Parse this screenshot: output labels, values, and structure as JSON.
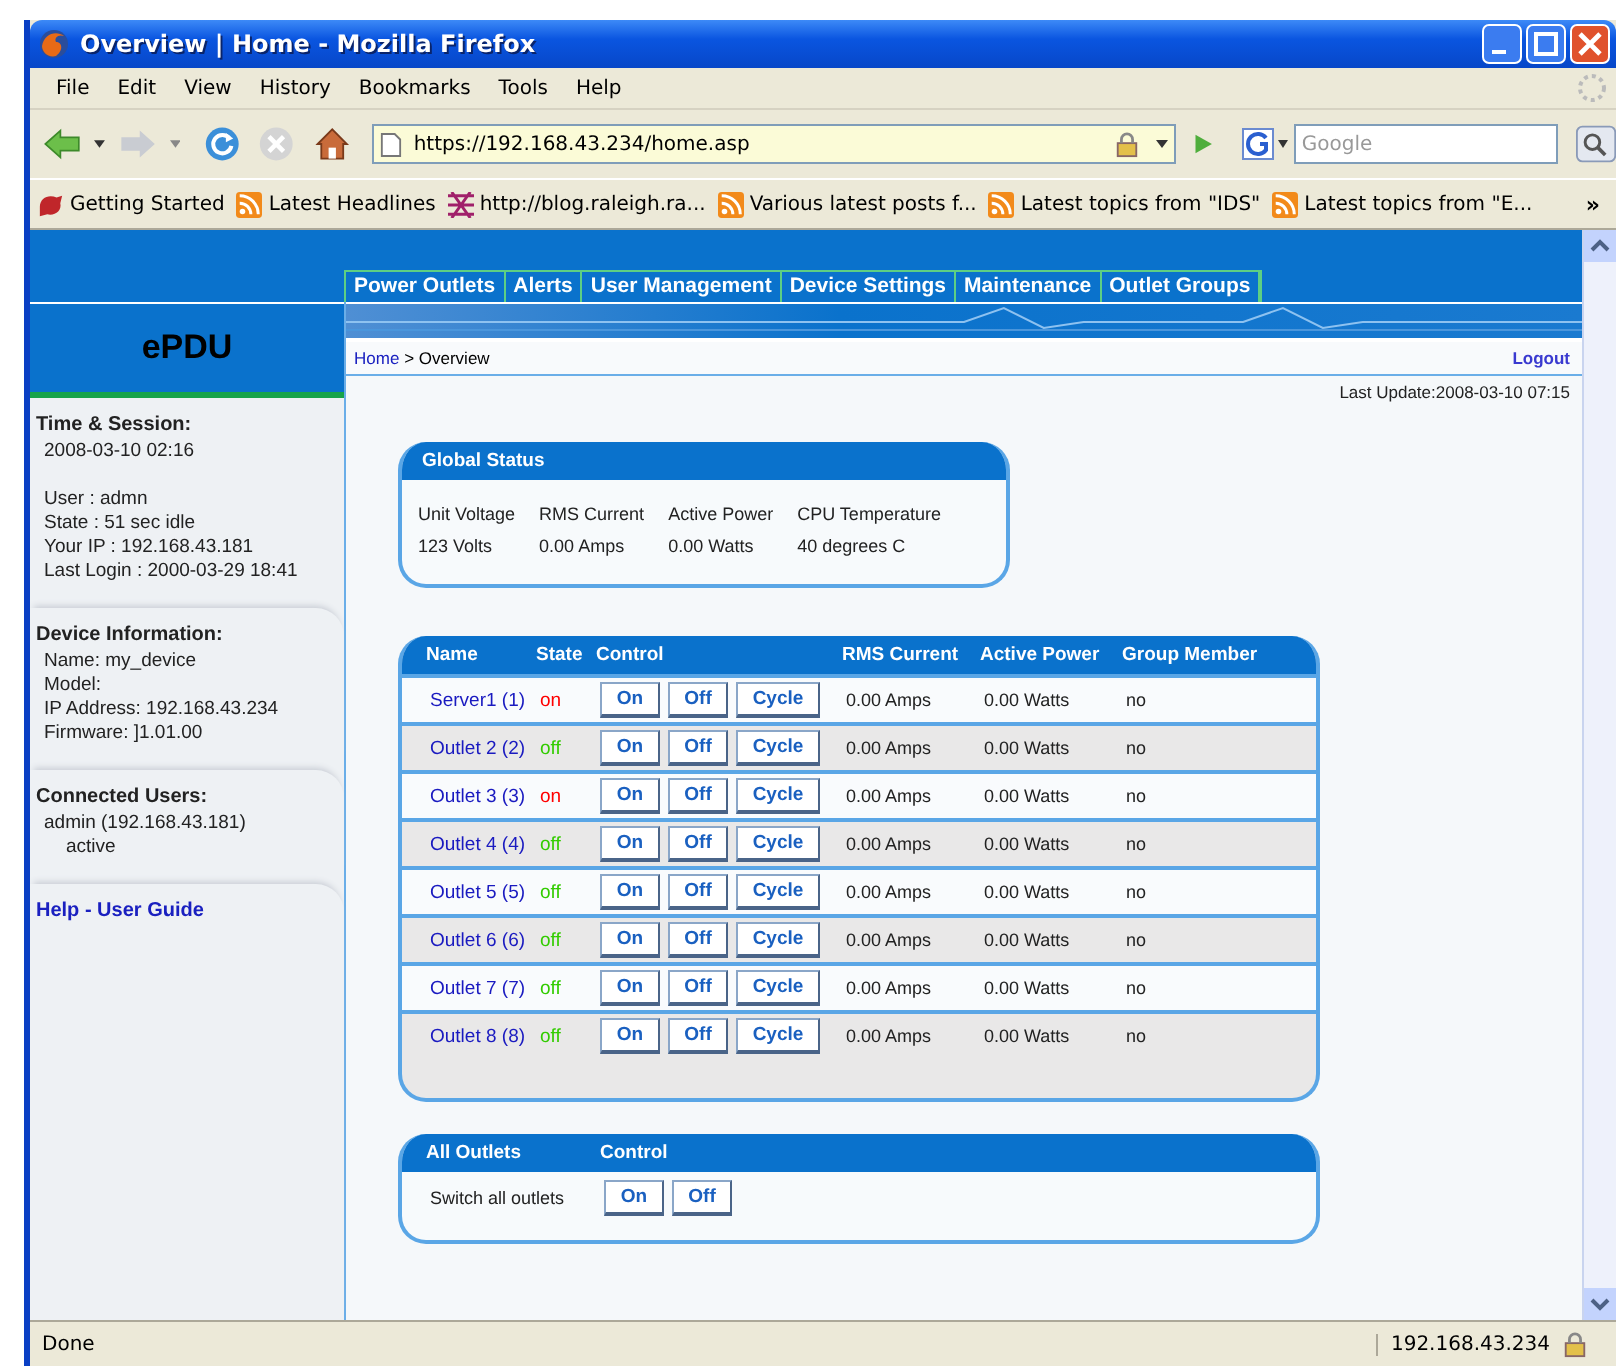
{
  "window": {
    "title": "Overview | Home - Mozilla Firefox"
  },
  "menu": [
    "File",
    "Edit",
    "View",
    "History",
    "Bookmarks",
    "Tools",
    "Help"
  ],
  "address": {
    "value": "https://192.168.43.234/home.asp"
  },
  "search": {
    "placeholder": "Google"
  },
  "bookmarks": [
    {
      "label": "Getting Started",
      "kind": "start"
    },
    {
      "label": "Latest Headlines",
      "kind": "feed"
    },
    {
      "label": "http://blog.raleigh.ra...",
      "kind": "site"
    },
    {
      "label": "Various latest posts f...",
      "kind": "feed"
    },
    {
      "label": "Latest topics from \"IDS\"",
      "kind": "feed"
    },
    {
      "label": "Latest topics from \"E...",
      "kind": "feed"
    }
  ],
  "bookmarks_more": "»",
  "tabs": [
    "Power Outlets",
    "Alerts",
    "User Management",
    "Device Settings",
    "Maintenance",
    "Outlet Groups"
  ],
  "brand": "ePDU",
  "breadcrumb": {
    "home": "Home",
    "current": "> Overview"
  },
  "logout": "Logout",
  "last_update": "Last Update:2008-03-10 07:15",
  "sidebar": [
    {
      "title": "Time & Session:",
      "blocks": [
        [
          "2008-03-10 02:16"
        ],
        [
          "User : admn",
          "State : 51 sec idle",
          "Your IP : 192.168.43.181",
          "Last Login : 2000-03-29 18:41"
        ]
      ]
    },
    {
      "title": "Device Information:",
      "blocks": [
        [
          "Name: my_device",
          "Model:",
          "IP Address: 192.168.43.234",
          "Firmware: ]1.01.00"
        ]
      ]
    },
    {
      "title": "Connected Users:",
      "blocks": [
        [
          "admin (192.168.43.181)",
          "active"
        ]
      ]
    }
  ],
  "help_link": "Help - User Guide",
  "global_status": {
    "title": "Global Status",
    "labels": [
      "Unit Voltage",
      "RMS Current",
      "Active Power",
      "CPU Temperature"
    ],
    "values": [
      "123 Volts",
      "0.00 Amps",
      "0.00 Watts",
      "40 degrees C"
    ]
  },
  "outlets": {
    "columns": [
      "Name",
      "State",
      "Control",
      "RMS Current",
      "Active Power",
      "Group Member"
    ],
    "rows": [
      {
        "name": "Server1 (1)",
        "state": "on",
        "color": "#ff0000",
        "buttons": [
          "On",
          "Off",
          "Cycle"
        ],
        "current": "0.00 Amps",
        "power": "0.00 Watts",
        "group": "no"
      },
      {
        "name": "Outlet 2 (2)",
        "state": "off",
        "color": "#33cc00",
        "buttons": [
          "On",
          "Off",
          "Cycle"
        ],
        "current": "0.00 Amps",
        "power": "0.00 Watts",
        "group": "no"
      },
      {
        "name": "Outlet 3 (3)",
        "state": "on",
        "color": "#ff0000",
        "buttons": [
          "On",
          "Off",
          "Cycle"
        ],
        "current": "0.00 Amps",
        "power": "0.00 Watts",
        "group": "no"
      },
      {
        "name": "Outlet 4 (4)",
        "state": "off",
        "color": "#33cc00",
        "buttons": [
          "On",
          "Off",
          "Cycle"
        ],
        "current": "0.00 Amps",
        "power": "0.00 Watts",
        "group": "no"
      },
      {
        "name": "Outlet 5 (5)",
        "state": "off",
        "color": "#33cc00",
        "buttons": [
          "On",
          "Off",
          "Cycle"
        ],
        "current": "0.00 Amps",
        "power": "0.00 Watts",
        "group": "no"
      },
      {
        "name": "Outlet 6 (6)",
        "state": "off",
        "color": "#33cc00",
        "buttons": [
          "On",
          "Off",
          "Cycle"
        ],
        "current": "0.00 Amps",
        "power": "0.00 Watts",
        "group": "no"
      },
      {
        "name": "Outlet 7 (7)",
        "state": "off",
        "color": "#33cc00",
        "buttons": [
          "On",
          "Off",
          "Cycle"
        ],
        "current": "0.00 Amps",
        "power": "0.00 Watts",
        "group": "no"
      },
      {
        "name": "Outlet 8 (8)",
        "state": "off",
        "color": "#33cc00",
        "buttons": [
          "On",
          "Off",
          "Cycle"
        ],
        "current": "0.00 Amps",
        "power": "0.00 Watts",
        "group": "no"
      }
    ]
  },
  "all_outlets": {
    "columns": [
      "All Outlets",
      "Control"
    ],
    "label": "Switch all outlets",
    "buttons": [
      "On",
      "Off"
    ]
  },
  "status_bar": {
    "text": "Done",
    "host": "192.168.43.234"
  }
}
